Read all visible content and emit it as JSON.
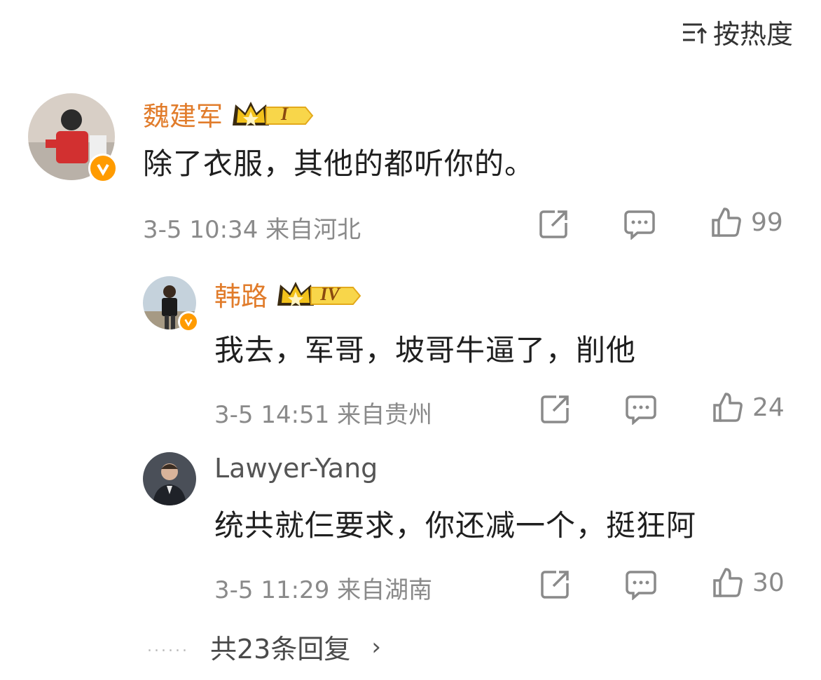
{
  "sort": {
    "label": "按热度"
  },
  "comments": [
    {
      "name": "魏建军",
      "level": "I",
      "text": "除了衣服，其他的都听你的。",
      "time": "3-5 10:34",
      "location": "来自河北",
      "likes": "99"
    },
    {
      "name": "韩路",
      "level": "IV",
      "text": "我去，军哥，坡哥牛逼了，削他",
      "time": "3-5 14:51",
      "location": "来自贵州",
      "likes": "24"
    },
    {
      "name": "Lawyer-Yang",
      "text": "统共就仨要求，你还减一个，挺狂阿",
      "time": "3-5 11:29",
      "location": "来自湖南",
      "likes": "30"
    }
  ],
  "replies": {
    "dots": "......",
    "label": "共23条回复",
    "chevron": "›"
  },
  "colors": {
    "name": "#e17c2b",
    "meta": "#8a8a8a",
    "verified": "#ff9b00",
    "crown": "#f3c21b"
  }
}
